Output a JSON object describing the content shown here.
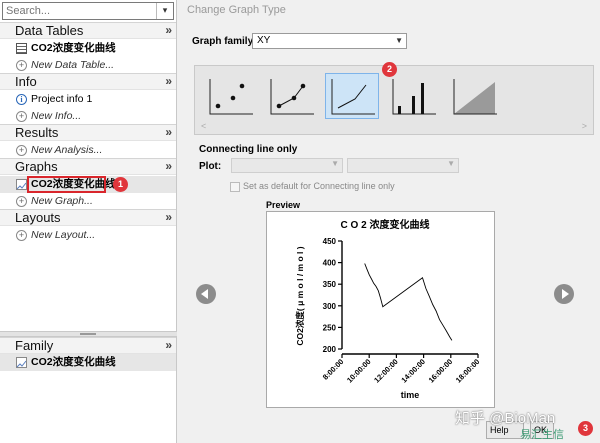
{
  "navigator": {
    "search_placeholder": "Search...",
    "sections": [
      {
        "title": "Data Tables",
        "items": [
          {
            "label": "CO2浓度变化曲线",
            "icon": "table-icon",
            "bold": true
          },
          {
            "label": "New Data Table...",
            "icon": "add-circle-icon",
            "new": true
          }
        ]
      },
      {
        "title": "Info",
        "items": [
          {
            "label": "Project info 1",
            "icon": "info-icon"
          },
          {
            "label": "New Info...",
            "icon": "add-circle-icon",
            "new": true
          }
        ]
      },
      {
        "title": "Results",
        "items": [
          {
            "label": "New Analysis...",
            "icon": "add-circle-icon",
            "new": true
          }
        ]
      },
      {
        "title": "Graphs",
        "items": [
          {
            "label": "CO2浓度变化曲线",
            "icon": "graph-icon",
            "bold": true,
            "selected": true,
            "badge": "1"
          },
          {
            "label": "New Graph...",
            "icon": "add-circle-icon",
            "new": true
          }
        ]
      },
      {
        "title": "Layouts",
        "items": [
          {
            "label": "New Layout...",
            "icon": "add-circle-icon",
            "new": true
          }
        ]
      }
    ],
    "family": {
      "title": "Family",
      "item": "CO2浓度变化曲线"
    }
  },
  "dialog": {
    "title": "Change Graph Type",
    "graph_family_label": "Graph family:",
    "graph_family_value": "XY",
    "graph_types": [
      "points-only",
      "points-and-connecting-line",
      "connecting-line-only",
      "spikes",
      "area-fill"
    ],
    "selected_type_badge": "2",
    "section_title": "Connecting line only",
    "plot_label": "Plot:",
    "default_checkbox_label": "Set as default for Connecting line only",
    "preview_label": "Preview",
    "help_button": "Help",
    "ok_button": "OK",
    "corner_badge": "3"
  },
  "watermark": {
    "line1": "知乎 @BioMan",
    "line2": "易汇生信"
  },
  "chart_data": {
    "type": "line",
    "title": "C O 2 浓度变化曲线",
    "xlabel": "time",
    "ylabel": "CO2浓度( μ m o l / m o l )",
    "x_ticks": [
      "8:00:00",
      "10:00:00",
      "12:00:00",
      "14:00:00",
      "16:00:00",
      "18:00:00"
    ],
    "y_ticks": [
      200,
      250,
      300,
      350,
      400,
      450
    ],
    "xlim": [
      "8:00:00",
      "18:00:00"
    ],
    "ylim": [
      200,
      450
    ],
    "series": [
      {
        "x": [
          "9:40:00",
          "9:50:00",
          "10:00:00",
          "10:10:00",
          "10:20:00",
          "10:30:00",
          "10:40:00",
          "10:50:00",
          "11:00:00",
          "13:55:00",
          "14:10:00",
          "14:25:00",
          "14:40:00",
          "14:55:00",
          "15:10:00",
          "15:25:00",
          "15:40:00",
          "15:55:00",
          "16:05:00"
        ],
        "y": [
          398,
          385,
          372,
          362,
          352,
          345,
          335,
          318,
          298,
          365,
          340,
          322,
          303,
          288,
          268,
          255,
          242,
          228,
          220
        ]
      }
    ]
  }
}
